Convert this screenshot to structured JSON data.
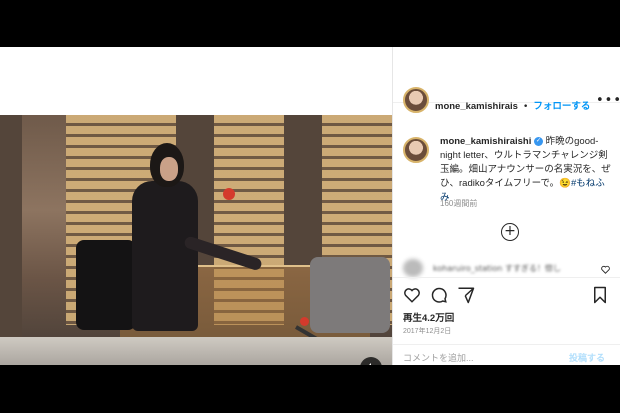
{
  "post": {
    "username": "mone_kamishirais",
    "separator": "•",
    "follow_label": "フォローする",
    "more_icon": "ellipsis-icon"
  },
  "caption": {
    "username": "mone_kamishiraishi",
    "text": "昨晩のgood-night letter、ウルトラマンチャレンジ剣玉編。畑山アナウンサーの名実況を、ぜひ、radikoタイムフリーで。😉",
    "hashtag": "#もねふみ",
    "time_ago": "160週間前"
  },
  "comment": {
    "username": "koharuiro_station",
    "text": "すすぎる！惚し"
  },
  "actions": {
    "like_icon": "heart-icon",
    "comment_icon": "comment-icon",
    "share_icon": "share-icon",
    "save_icon": "bookmark-icon",
    "views": "再生4.2万回",
    "date": "2017年12月2日"
  },
  "add_comment": {
    "placeholder": "コメントを追加...",
    "post_label": "投稿する"
  },
  "video": {
    "mute_icon": "speaker-muted-icon"
  },
  "colors": {
    "accent": "#0095f6",
    "text": "#262626",
    "muted": "#8e8e8e"
  }
}
